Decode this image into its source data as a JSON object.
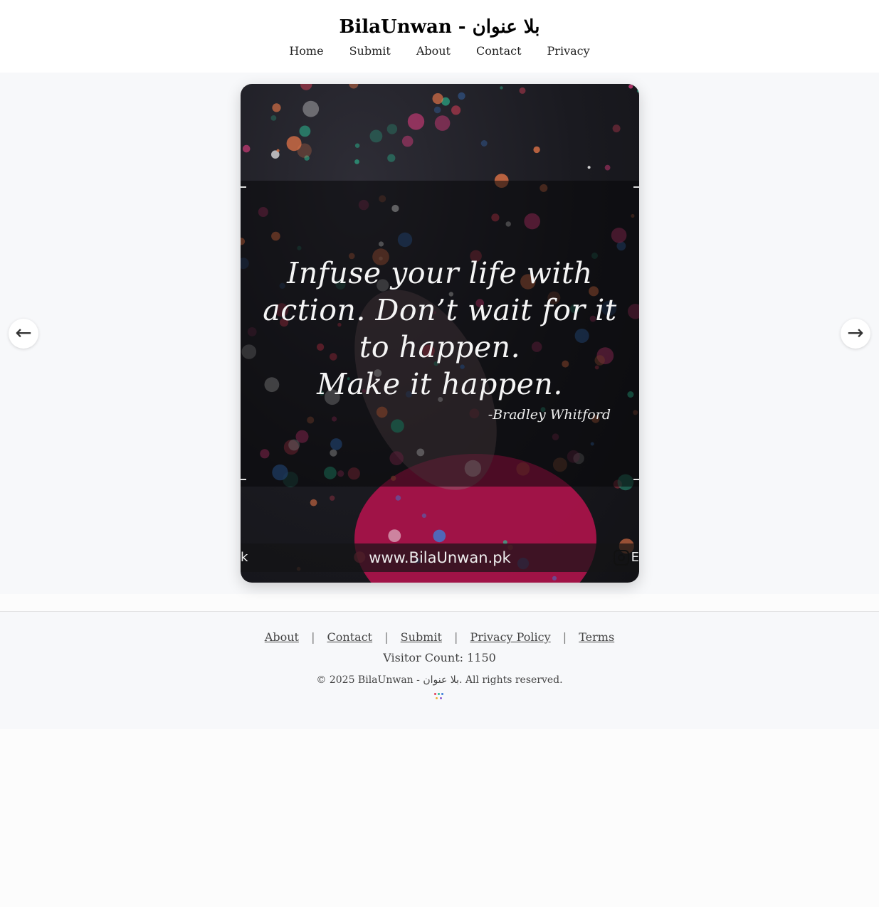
{
  "header": {
    "title": "BilaUnwan - بلا عنوان",
    "nav": [
      "Home",
      "Submit",
      "About",
      "Contact",
      "Privacy"
    ]
  },
  "carousel": {
    "prev_icon": "←",
    "next_icon": "→",
    "image": {
      "quote_lines": [
        "Infuse your life with",
        "action. Don’t wait for it",
        "to happen.",
        "Make it happen."
      ],
      "author": "-Bradley Whitford",
      "url": "www.BilaUnwan.pk",
      "strip_left": "k",
      "strip_right": "E"
    }
  },
  "footer": {
    "links": [
      "About",
      "Contact",
      "Submit",
      "Privacy Policy",
      "Terms"
    ],
    "separator": "|",
    "visitor_count": "Visitor Count: 1150",
    "copyright": "© 2025 BilaUnwan - بلا عنوان. All rights reserved."
  },
  "colors": {
    "page_bg": "#fcfcfc",
    "band_bg": "#f7f8fa",
    "bokeh": [
      "#e2405a",
      "#2bbf95",
      "#3b7fd8",
      "#d33b7a",
      "#f07a4a",
      "#ffffff"
    ]
  }
}
